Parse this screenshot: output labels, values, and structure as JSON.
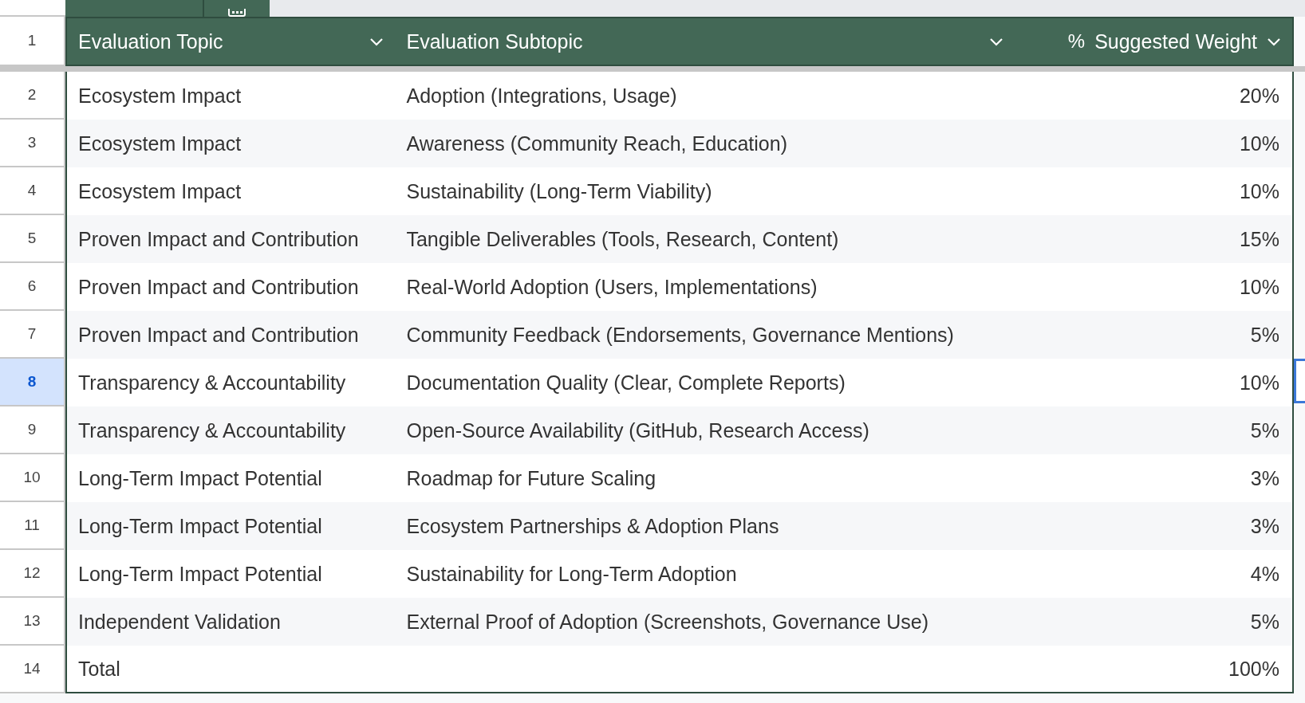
{
  "header": {
    "row_number": "1",
    "columns": [
      {
        "label": "Evaluation Topic"
      },
      {
        "label": "Evaluation Subtopic"
      },
      {
        "label": "Suggested Weight",
        "type_icon": "%"
      }
    ]
  },
  "rows": [
    {
      "number": "2",
      "topic": "Ecosystem Impact",
      "subtopic": "Adoption (Integrations, Usage)",
      "weight": "20%",
      "selected": false
    },
    {
      "number": "3",
      "topic": "Ecosystem Impact",
      "subtopic": "Awareness (Community Reach, Education)",
      "weight": "10%",
      "selected": false
    },
    {
      "number": "4",
      "topic": "Ecosystem Impact",
      "subtopic": "Sustainability (Long-Term Viability)",
      "weight": "10%",
      "selected": false
    },
    {
      "number": "5",
      "topic": "Proven Impact and Contribution",
      "subtopic": "Tangible Deliverables (Tools, Research, Content)",
      "weight": "15%",
      "selected": false
    },
    {
      "number": "6",
      "topic": "Proven Impact and Contribution",
      "subtopic": "Real-World Adoption (Users, Implementations)",
      "weight": "10%",
      "selected": false
    },
    {
      "number": "7",
      "topic": "Proven Impact and Contribution",
      "subtopic": "Community Feedback (Endorsements, Governance Mentions)",
      "weight": "5%",
      "selected": false
    },
    {
      "number": "8",
      "topic": "Transparency & Accountability",
      "subtopic": "Documentation Quality (Clear, Complete Reports)",
      "weight": "10%",
      "selected": true
    },
    {
      "number": "9",
      "topic": "Transparency & Accountability",
      "subtopic": "Open-Source Availability (GitHub, Research Access)",
      "weight": "5%",
      "selected": false
    },
    {
      "number": "10",
      "topic": "Long-Term Impact Potential",
      "subtopic": "Roadmap for Future Scaling",
      "weight": "3%",
      "selected": false
    },
    {
      "number": "11",
      "topic": "Long-Term Impact Potential",
      "subtopic": "Ecosystem Partnerships & Adoption Plans",
      "weight": "3%",
      "selected": false
    },
    {
      "number": "12",
      "topic": "Long-Term Impact Potential",
      "subtopic": "Sustainability for Long-Term Adoption",
      "weight": "4%",
      "selected": false
    },
    {
      "number": "13",
      "topic": "Independent Validation",
      "subtopic": "External Proof of Adoption (Screenshots, Governance Use)",
      "weight": "5%",
      "selected": false
    },
    {
      "number": "14",
      "topic": "Total",
      "weight": "100%",
      "selected": false
    }
  ]
}
